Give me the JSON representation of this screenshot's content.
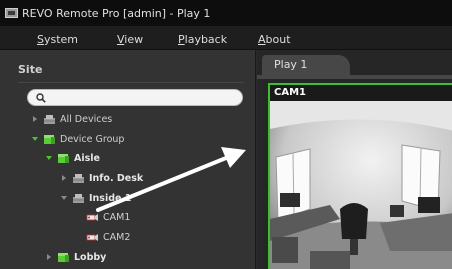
{
  "window": {
    "title": "REVO Remote Pro [admin] - Play 1"
  },
  "menu": [
    {
      "underline": "S",
      "rest": "ystem"
    },
    {
      "underline": "V",
      "rest": "iew"
    },
    {
      "underline": "P",
      "rest": "layback"
    },
    {
      "underline": "A",
      "rest": "bout"
    }
  ],
  "sidebar": {
    "header": "Site",
    "search": {
      "value": "",
      "placeholder": ""
    },
    "tree": [
      {
        "label": "All Devices",
        "level": 0,
        "icon": "devices-icon",
        "expander": "collapsed"
      },
      {
        "label": "Device Group",
        "level": 0,
        "icon": "group-icon",
        "expander": "expanded"
      },
      {
        "label": "Aisle",
        "level": 1,
        "icon": "group-icon",
        "expander": "expanded"
      },
      {
        "label": "Info. Desk",
        "level": 2,
        "icon": "devices-icon",
        "expander": "collapsed"
      },
      {
        "label": "Inside 1",
        "level": 2,
        "icon": "devices-icon",
        "expander": "expanded"
      },
      {
        "label": "CAM1",
        "level": 3,
        "icon": "camera-icon",
        "expander": "none"
      },
      {
        "label": "CAM2",
        "level": 3,
        "icon": "camera-icon",
        "expander": "none"
      },
      {
        "label": "Lobby",
        "level": 1,
        "icon": "group-icon",
        "expander": "collapsed"
      }
    ]
  },
  "tabs": [
    {
      "label": "Play  1",
      "active": true
    }
  ],
  "camera_panel": {
    "label": "CAM1",
    "selected": true
  },
  "colors": {
    "selection_border": "#3fbf2f",
    "group_icon": "#5ccb3a"
  }
}
